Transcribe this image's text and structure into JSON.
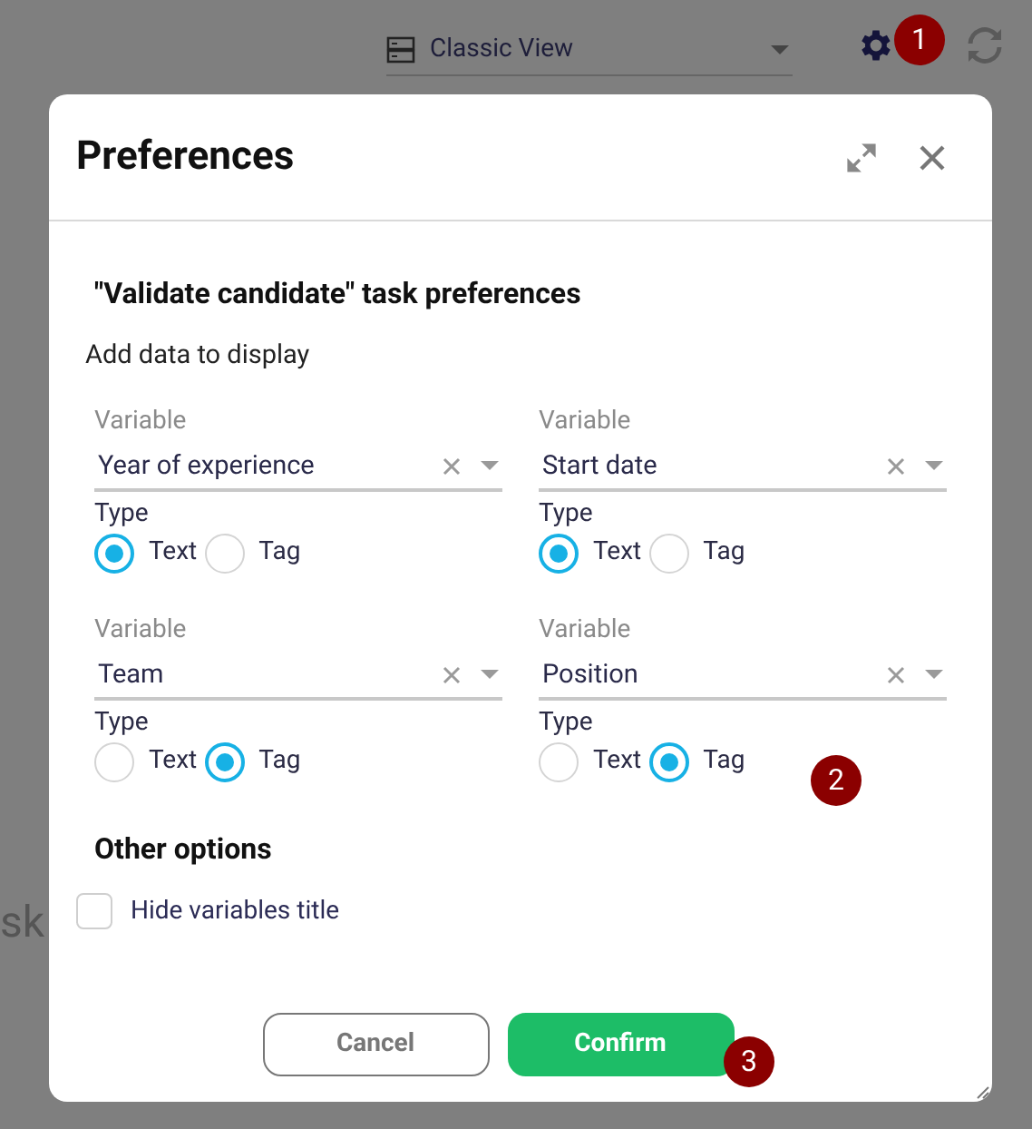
{
  "top_bar": {
    "view_select": {
      "value": "Classic View"
    }
  },
  "background_text": "sk",
  "dialog": {
    "title": "Preferences",
    "section_title": "\"Validate candidate\" task preferences",
    "subtitle": "Add data to display",
    "variables": [
      {
        "label": "Variable",
        "value": "Year of experience",
        "type_label": "Type",
        "options": [
          {
            "label": "Text",
            "selected": true
          },
          {
            "label": "Tag",
            "selected": false
          }
        ]
      },
      {
        "label": "Variable",
        "value": "Start date",
        "type_label": "Type",
        "options": [
          {
            "label": "Text",
            "selected": true
          },
          {
            "label": "Tag",
            "selected": false
          }
        ]
      },
      {
        "label": "Variable",
        "value": "Team",
        "type_label": "Type",
        "options": [
          {
            "label": "Text",
            "selected": false
          },
          {
            "label": "Tag",
            "selected": true
          }
        ]
      },
      {
        "label": "Variable",
        "value": "Position",
        "type_label": "Type",
        "options": [
          {
            "label": "Text",
            "selected": false
          },
          {
            "label": "Tag",
            "selected": true
          }
        ]
      }
    ],
    "other_options": {
      "title": "Other options",
      "checkboxes": [
        {
          "label": "Hide variables title",
          "checked": false
        }
      ]
    },
    "buttons": [
      {
        "label": "Cancel",
        "kind": "secondary"
      },
      {
        "label": "Confirm",
        "kind": "primary"
      }
    ]
  },
  "markers": [
    "1",
    "2",
    "3"
  ]
}
